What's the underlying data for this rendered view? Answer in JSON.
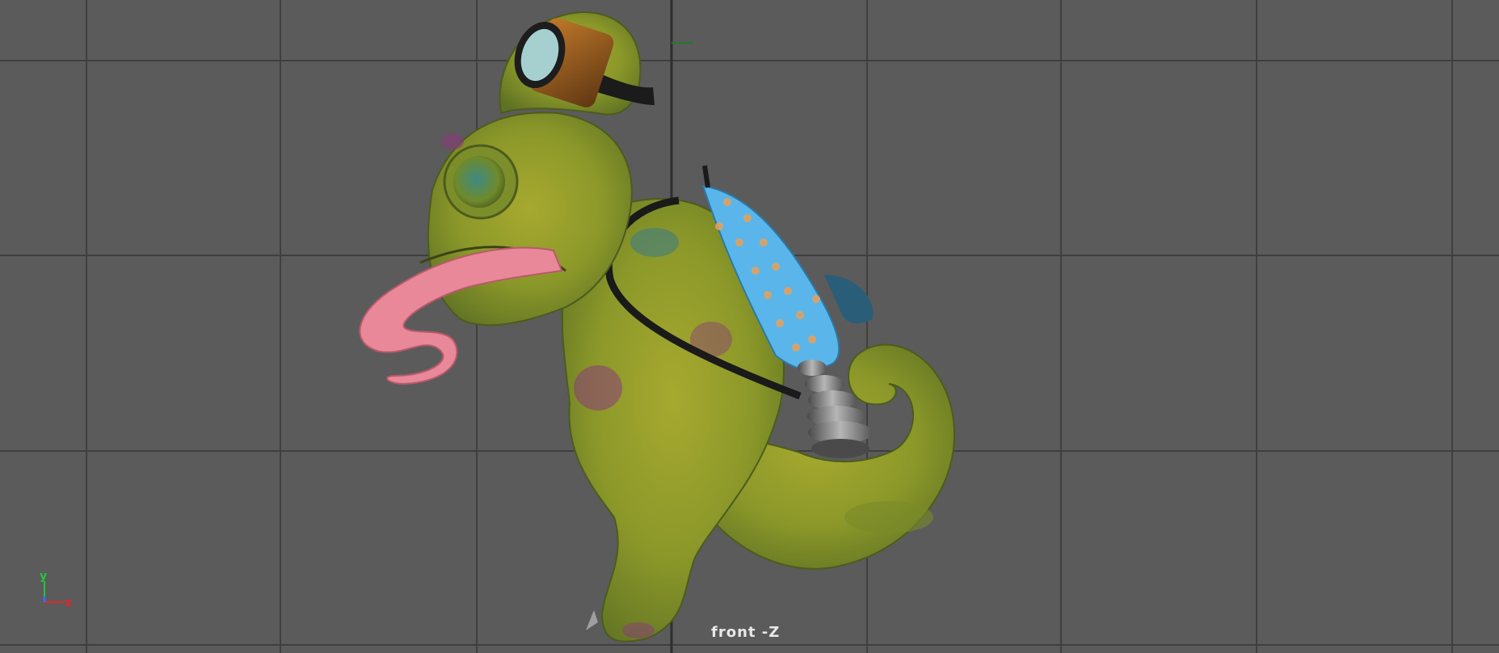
{
  "viewport": {
    "camera": "front -Z",
    "background_color": "#5b5b5b",
    "grid_color": "#3f3f3f",
    "origin_marker_color": "#1f7a2f"
  },
  "axis_gizmo": {
    "y_label": "y",
    "x_label": "x",
    "y_color": "#22c83a",
    "x_color": "#e82424",
    "z_color": "#3a6cff"
  },
  "model": {
    "character": "chameleon",
    "skin_color": "#8a9a2a",
    "tongue_color": "#e98898",
    "backpack_color": "#5ab6ea",
    "thruster_color": "#6e6e6e",
    "goggles_color": "#9a6020"
  }
}
